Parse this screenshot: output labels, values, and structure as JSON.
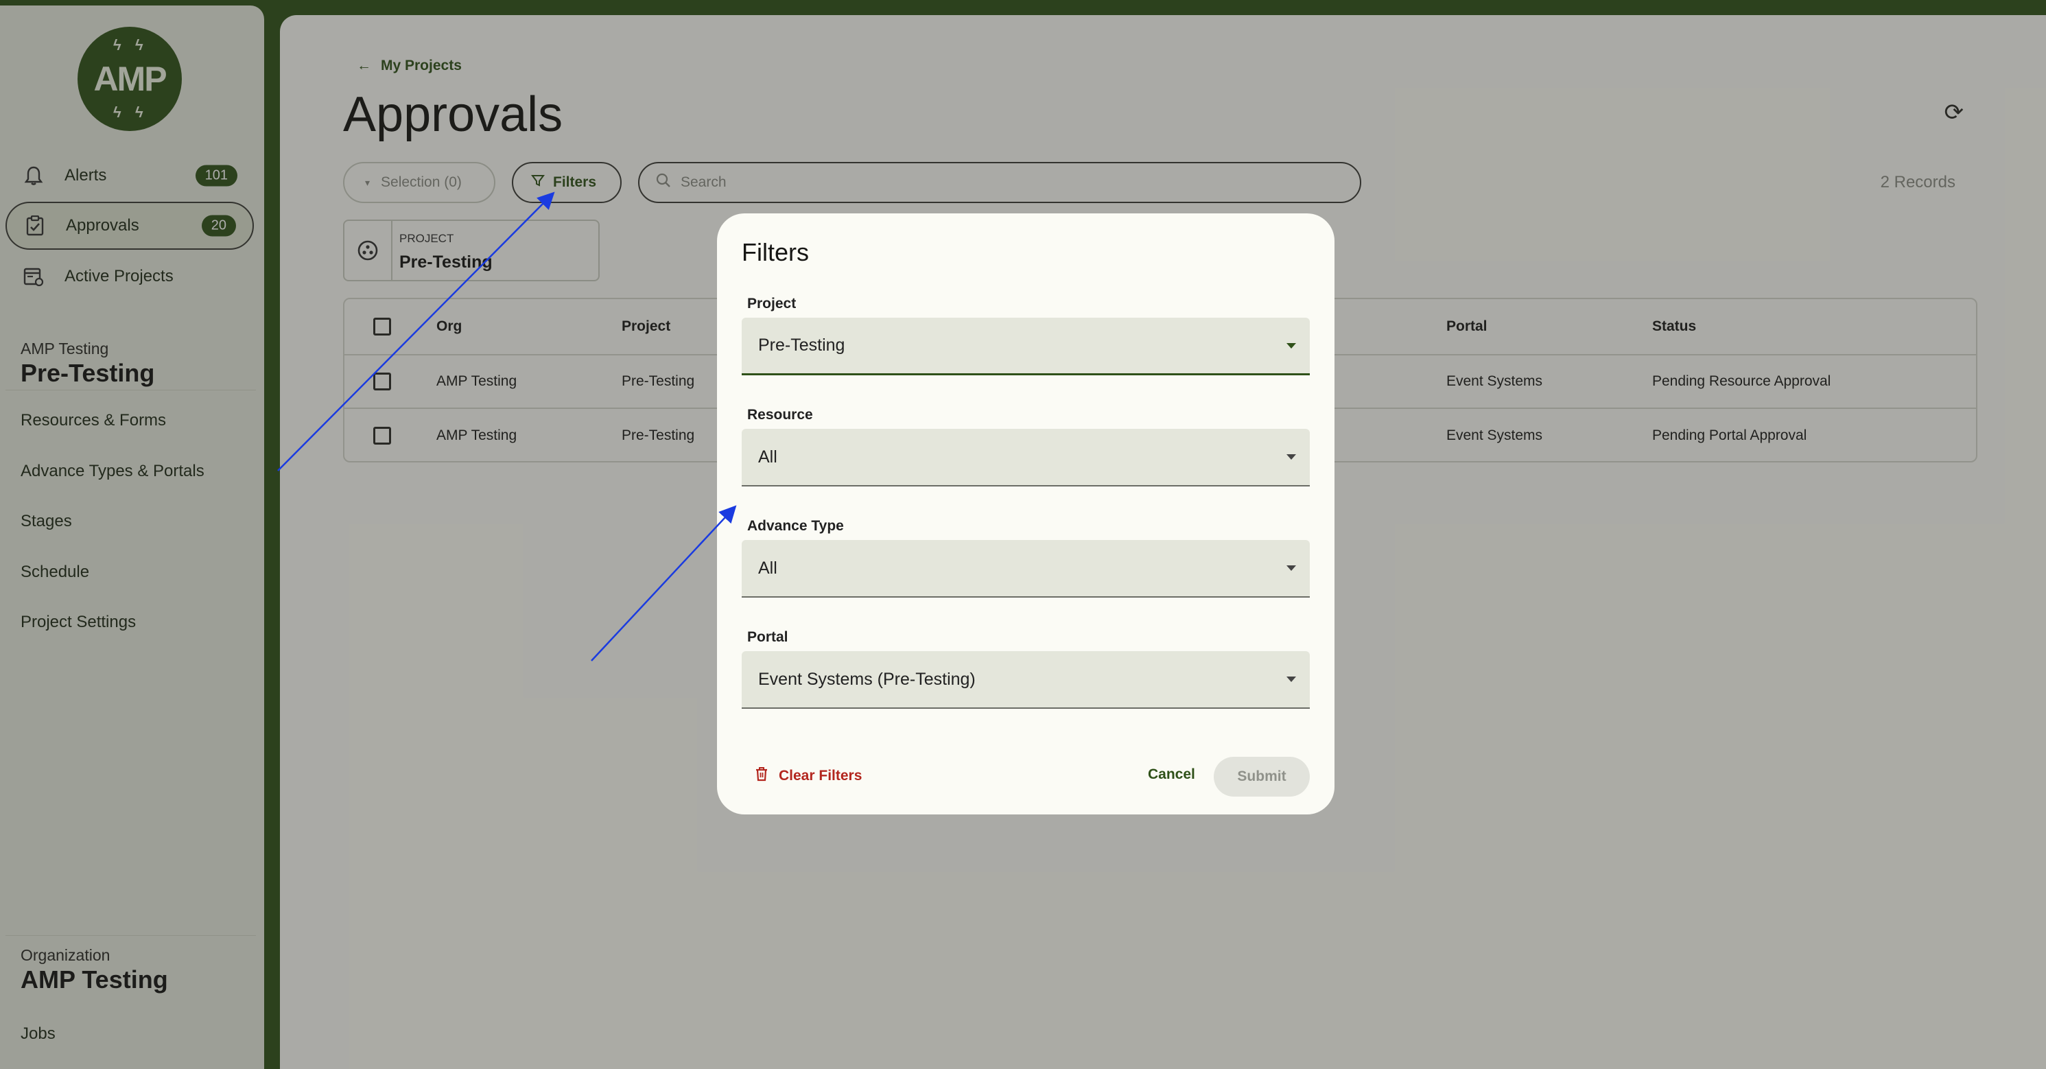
{
  "sidebar": {
    "logo_text": "AMP",
    "nav": [
      {
        "label": "Alerts",
        "badge": "101",
        "icon": "bell-icon"
      },
      {
        "label": "Approvals",
        "badge": "20",
        "icon": "clipboard-check-icon"
      },
      {
        "label": "Active Projects",
        "icon": "calendar-list-icon"
      }
    ],
    "project_section": {
      "org": "AMP Testing",
      "project": "Pre-Testing",
      "links": [
        "Resources & Forms",
        "Advance Types & Portals",
        "Stages",
        "Schedule",
        "Project Settings"
      ]
    },
    "org_section": {
      "label": "Organization",
      "name": "AMP Testing",
      "links": [
        "Jobs"
      ]
    }
  },
  "main": {
    "breadcrumb": "My Projects",
    "title": "Approvals",
    "selection_label": "Selection (0)",
    "filters_label": "Filters",
    "search_placeholder": "Search",
    "records": "2 Records",
    "project_chip": {
      "label": "PROJECT",
      "value": "Pre-Testing"
    },
    "table": {
      "columns": [
        "Org",
        "Project",
        "Portal",
        "Status"
      ],
      "rows": [
        {
          "org": "AMP Testing",
          "project": "Pre-Testing",
          "portal": "Event Systems",
          "status": "Pending Resource Approval"
        },
        {
          "org": "AMP Testing",
          "project": "Pre-Testing",
          "portal": "Event Systems",
          "status": "Pending Portal Approval"
        }
      ]
    }
  },
  "dialog": {
    "title": "Filters",
    "fields": [
      {
        "label": "Project",
        "value": "Pre-Testing"
      },
      {
        "label": "Resource",
        "value": "All"
      },
      {
        "label": "Advance Type",
        "value": "All"
      },
      {
        "label": "Portal",
        "value": "Event Systems (Pre-Testing)"
      }
    ],
    "clear_label": "Clear Filters",
    "cancel_label": "Cancel",
    "submit_label": "Submit"
  },
  "colors": {
    "brand": "#2f5119",
    "danger": "#b3261e",
    "annotation_arrow": "#1a3be0"
  }
}
